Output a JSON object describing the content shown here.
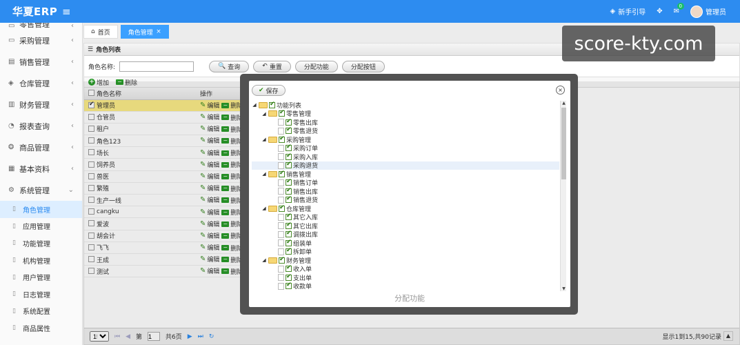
{
  "app": {
    "title": "华夏ERP",
    "menu_icon": "hamburger-icon"
  },
  "header": {
    "guide": "新手引导",
    "notification_count": "0",
    "user": "管理员"
  },
  "sidebar": {
    "partial_top": "零售管理",
    "items": [
      {
        "label": "采购管理",
        "icon": "▭"
      },
      {
        "label": "销售管理",
        "icon": "▤"
      },
      {
        "label": "仓库管理",
        "icon": "◈"
      },
      {
        "label": "财务管理",
        "icon": "▥"
      },
      {
        "label": "报表查询",
        "icon": "◔"
      },
      {
        "label": "商品管理",
        "icon": "❂"
      },
      {
        "label": "基本资料",
        "icon": "▦"
      },
      {
        "label": "系统管理",
        "icon": "⚙"
      }
    ],
    "subitems": [
      "角色管理",
      "应用管理",
      "功能管理",
      "机构管理",
      "用户管理",
      "日志管理",
      "系统配置",
      "商品属性"
    ]
  },
  "tabs": [
    {
      "label": "首页"
    },
    {
      "label": "角色管理"
    }
  ],
  "panel": {
    "title": "角色列表",
    "search_label": "角色名称:",
    "buttons": {
      "query": "查询",
      "reset": "重置",
      "assign_func": "分配功能",
      "assign_button": "分配按钮"
    },
    "toolbar": {
      "add": "增加",
      "delete": "删除"
    },
    "columns": {
      "name": "角色名称",
      "ops": "操作"
    },
    "edit_label": "编辑",
    "delete_label": "删除",
    "rows": [
      "管理员",
      "仓管员",
      "租户",
      "角色123",
      "场长",
      "饲养员",
      "兽医",
      "繁殖",
      "生产一线",
      "cangku",
      "爱波",
      "胡会计",
      "飞飞",
      "王成",
      "测试"
    ]
  },
  "footer": {
    "page_size": "15",
    "page_prefix": "第",
    "page": "1",
    "page_suffix": "共6页",
    "info": "显示1到15,共90记录"
  },
  "modal": {
    "save": "保存",
    "title": "分配功能",
    "tree": [
      {
        "level": 0,
        "label": "功能列表",
        "folder": true
      },
      {
        "level": 1,
        "label": "零售管理",
        "folder": true
      },
      {
        "level": 2,
        "label": "零售出库"
      },
      {
        "level": 2,
        "label": "零售退货"
      },
      {
        "level": 1,
        "label": "采购管理",
        "folder": true
      },
      {
        "level": 2,
        "label": "采购订单"
      },
      {
        "level": 2,
        "label": "采购入库"
      },
      {
        "level": 2,
        "label": "采购退货"
      },
      {
        "level": 1,
        "label": "销售管理",
        "folder": true
      },
      {
        "level": 2,
        "label": "销售订单"
      },
      {
        "level": 2,
        "label": "销售出库"
      },
      {
        "level": 2,
        "label": "销售退货"
      },
      {
        "level": 1,
        "label": "仓库管理",
        "folder": true
      },
      {
        "level": 2,
        "label": "其它入库"
      },
      {
        "level": 2,
        "label": "其它出库"
      },
      {
        "level": 2,
        "label": "调拨出库"
      },
      {
        "level": 2,
        "label": "组装单"
      },
      {
        "level": 2,
        "label": "拆卸单"
      },
      {
        "level": 1,
        "label": "财务管理",
        "folder": true
      },
      {
        "level": 2,
        "label": "收入单"
      },
      {
        "level": 2,
        "label": "支出单"
      },
      {
        "level": 2,
        "label": "收款单"
      }
    ]
  },
  "watermark": "score-kty.com"
}
